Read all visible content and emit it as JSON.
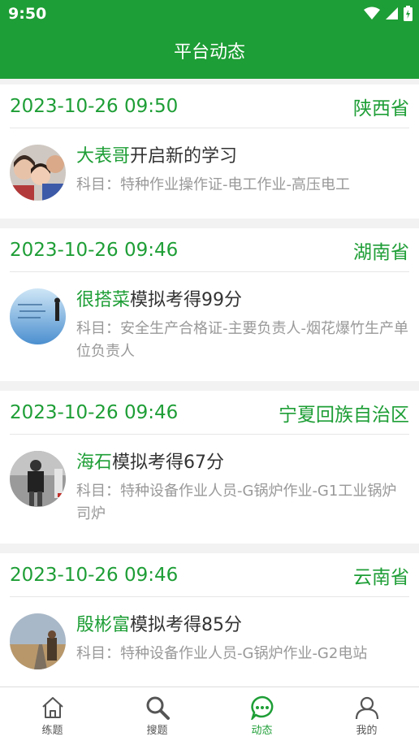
{
  "status_bar": {
    "time": "9:50"
  },
  "app_bar": {
    "title": "平台动态"
  },
  "feed": [
    {
      "date": "2023-10-26 09:50",
      "province": "陕西省",
      "name": "大表哥",
      "action": "开启新的学习",
      "subject": "科目：特种作业操作证-电工作业-高压电工",
      "avatar_color": "#8a6a5a"
    },
    {
      "date": "2023-10-26 09:46",
      "province": "湖南省",
      "name": "很搭菜",
      "action": "模拟考得99分",
      "subject": "科目：安全生产合格证-主要负责人-烟花爆竹生产单位负责人",
      "avatar_color": "#5aa0d8"
    },
    {
      "date": "2023-10-26 09:46",
      "province": "宁夏回族自治区",
      "name": "海石",
      "action": "模拟考得67分",
      "subject": "科目：特种设备作业人员-G锅炉作业-G1工业锅炉司炉",
      "avatar_color": "#6b6b6b"
    },
    {
      "date": "2023-10-26 09:46",
      "province": "云南省",
      "name": "殷彬富",
      "action": "模拟考得85分",
      "subject": "科目：特种设备作业人员-G锅炉作业-G2电站",
      "avatar_color": "#b89a70"
    }
  ],
  "tabs": [
    {
      "label": "练题",
      "icon": "home-icon"
    },
    {
      "label": "搜题",
      "icon": "search-icon"
    },
    {
      "label": "动态",
      "icon": "chat-icon",
      "active": true
    },
    {
      "label": "我的",
      "icon": "user-icon"
    }
  ],
  "colors": {
    "accent": "#1e9e36"
  }
}
